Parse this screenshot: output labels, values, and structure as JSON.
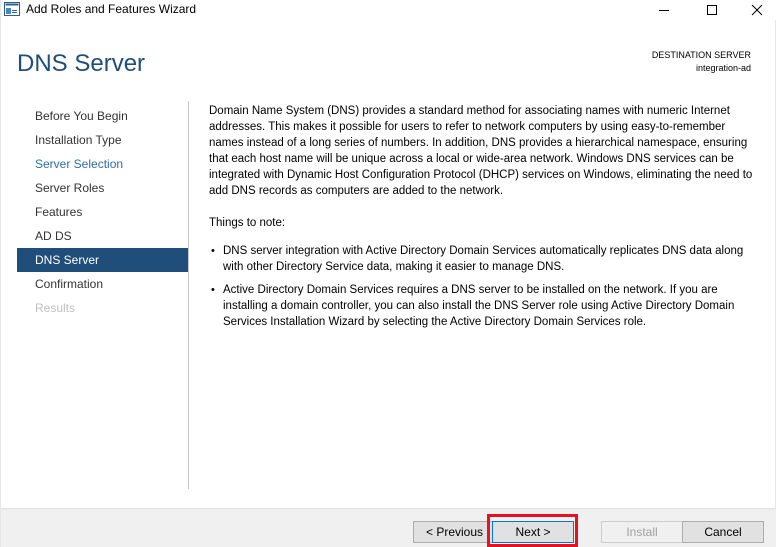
{
  "window": {
    "title": "Add Roles and Features Wizard"
  },
  "header": {
    "page_title": "DNS Server",
    "destination_label": "DESTINATION SERVER",
    "destination_name": "integration-ad"
  },
  "nav": {
    "items": [
      {
        "label": "Before You Begin",
        "state": "normal"
      },
      {
        "label": "Installation Type",
        "state": "normal"
      },
      {
        "label": "Server Selection",
        "state": "visited"
      },
      {
        "label": "Server Roles",
        "state": "normal"
      },
      {
        "label": "Features",
        "state": "normal"
      },
      {
        "label": "AD DS",
        "state": "normal"
      },
      {
        "label": "DNS Server",
        "state": "active"
      },
      {
        "label": "Confirmation",
        "state": "normal"
      },
      {
        "label": "Results",
        "state": "disabled"
      }
    ]
  },
  "content": {
    "intro": "Domain Name System (DNS) provides a standard method for associating names with numeric Internet addresses. This makes it possible for users to refer to network computers by using easy-to-remember names instead of a long series of numbers. In addition, DNS provides a hierarchical namespace, ensuring that each host name will be unique across a local or wide-area network. Windows DNS services can be integrated with Dynamic Host Configuration Protocol (DHCP) services on Windows, eliminating the need to add DNS records as computers are added to the network.",
    "notes_title": "Things to note:",
    "bullets": [
      "DNS server integration with Active Directory Domain Services automatically replicates DNS data along with other Directory Service data, making it easier to manage DNS.",
      "Active Directory Domain Services requires a DNS server to be installed on the network. If you are installing a domain controller, you can also install the DNS Server role using Active Directory Domain Services Installation Wizard by selecting the Active Directory Domain Services role."
    ]
  },
  "footer": {
    "previous_label": "< Previous",
    "next_label": "Next >",
    "install_label": "Install",
    "cancel_label": "Cancel"
  },
  "colors": {
    "title_blue": "#1e4e79",
    "active_nav_bg": "#1e4e79",
    "visited_nav": "#2e6da4",
    "highlight_red": "#e81123"
  },
  "icons": {
    "app": "server-manager-icon",
    "minimize": "minimize-icon",
    "maximize": "maximize-icon",
    "close": "close-icon"
  }
}
